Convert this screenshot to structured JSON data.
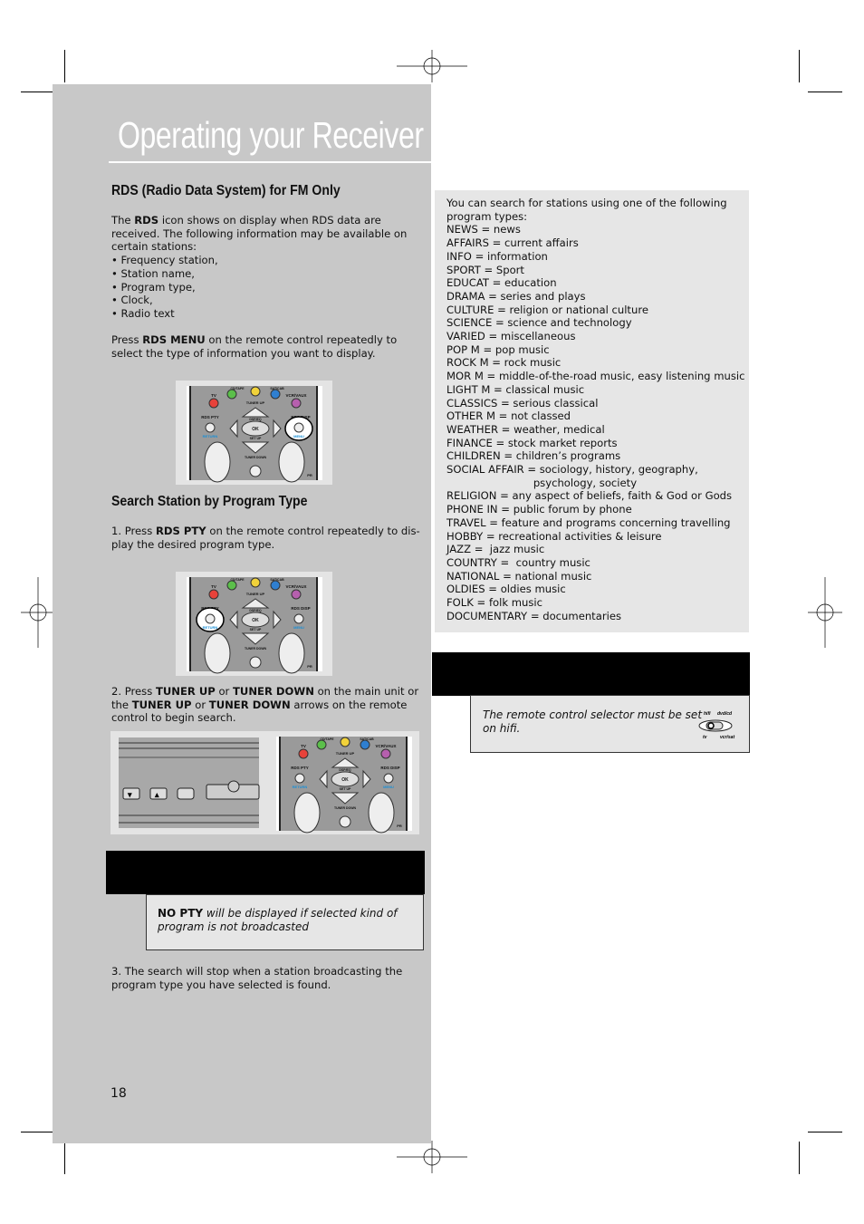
{
  "page": {
    "title": "Operating your Receiver",
    "page_number": "18"
  },
  "rds": {
    "heading": "RDS (Radio Data System) for FM Only",
    "intro": [
      [
        "The ",
        "RDS",
        " icon shows on display when RDS data are"
      ],
      [
        "received.  The following information may be available on"
      ],
      [
        "certain stations:"
      ],
      [
        "• Frequency station,"
      ],
      [
        "• Station name,"
      ],
      [
        "• Program type,"
      ],
      [
        "• Clock,"
      ],
      [
        "• Radio text"
      ]
    ],
    "press": [
      [
        "Press ",
        "RDS MENU",
        " on the remote control repeatedly to"
      ],
      [
        "select the type of information you want to display."
      ]
    ]
  },
  "search": {
    "heading": "Search Station by Program Type",
    "step1": [
      [
        "1.  Press ",
        "RDS PTY",
        " on the remote control repeatedly to dis-"
      ],
      [
        "play the desired program type."
      ]
    ],
    "step2": [
      [
        "2. Press ",
        "TUNER UP",
        " or ",
        "TUNER DOWN",
        " on the main unit or"
      ],
      [
        "the ",
        "TUNER UP",
        " or ",
        "TUNER DOWN",
        " arrows on the remote"
      ],
      [
        "control to  begin search."
      ]
    ],
    "note_bold": "NO PTY",
    "note_text_1": " will be displayed if selected kind of",
    "note_text_2": "program is not broadcasted",
    "step3": [
      [
        "3.  The search will stop when a station broadcasting the"
      ],
      [
        "program type you have selected is found."
      ]
    ]
  },
  "remote_labels": {
    "tv": "TV",
    "cdtape": "CD/TAPE",
    "tuner": "TUNER",
    "satcab": "SAT/CAB",
    "vcraux": "VCR/VAUX",
    "tuner_up": "TUNER UP",
    "tuner_down": "TUNER DOWN",
    "rds_pty": "RDS PTY",
    "rds_disp": "RDS DISP",
    "dsp": "DSP/EQ",
    "ok": "OK",
    "setup": "SET UP",
    "return": "RETURN",
    "menu": "MENU",
    "pr": "PR"
  },
  "program_types": {
    "intro": [
      "You can search for stations using one of the following",
      "program types:"
    ],
    "items": [
      "NEWS = news",
      "AFFAIRS = current affairs",
      "INFO = information",
      "SPORT = Sport",
      "EDUCAT = education",
      "DRAMA = series and plays",
      "CULTURE = religion or national culture",
      "SCIENCE = science and technology",
      "VARIED = miscellaneous",
      "POP M = pop music",
      "ROCK M = rock music",
      "MOR M = middle-of-the-road music, easy listening music",
      "LIGHT M = classical music",
      "CLASSICS = serious classical",
      "OTHER M = not classed",
      "WEATHER = weather, medical",
      "FINANCE = stock market reports",
      "CHILDREN = children’s programs",
      "SOCIAL AFFAIR = sociology, history, geography,",
      "                          psychology, society",
      "RELIGION = any aspect of beliefs, faith & God or Gods",
      "PHONE IN = public forum by phone",
      "TRAVEL = feature and programs concerning travelling",
      "HOBBY = recreational activities & leisure",
      "JAZZ =  jazz music",
      "COUNTRY =  country music",
      "NATIONAL = national music",
      "OLDIES = oldies music",
      "FOLK = folk music",
      "DOCUMENTARY = documentaries"
    ]
  },
  "selector_note": {
    "text_1": "The remote control selector must be set",
    "text_2": "on hifi.",
    "switch_labels": [
      "hifi",
      "dvd/cd",
      "tv",
      "vcr/sat"
    ]
  },
  "colors": {
    "panel": "#c8c8c8",
    "box": "#e6e6e6",
    "title": "#ffffff",
    "accent_blue": "#1a8fd6"
  }
}
